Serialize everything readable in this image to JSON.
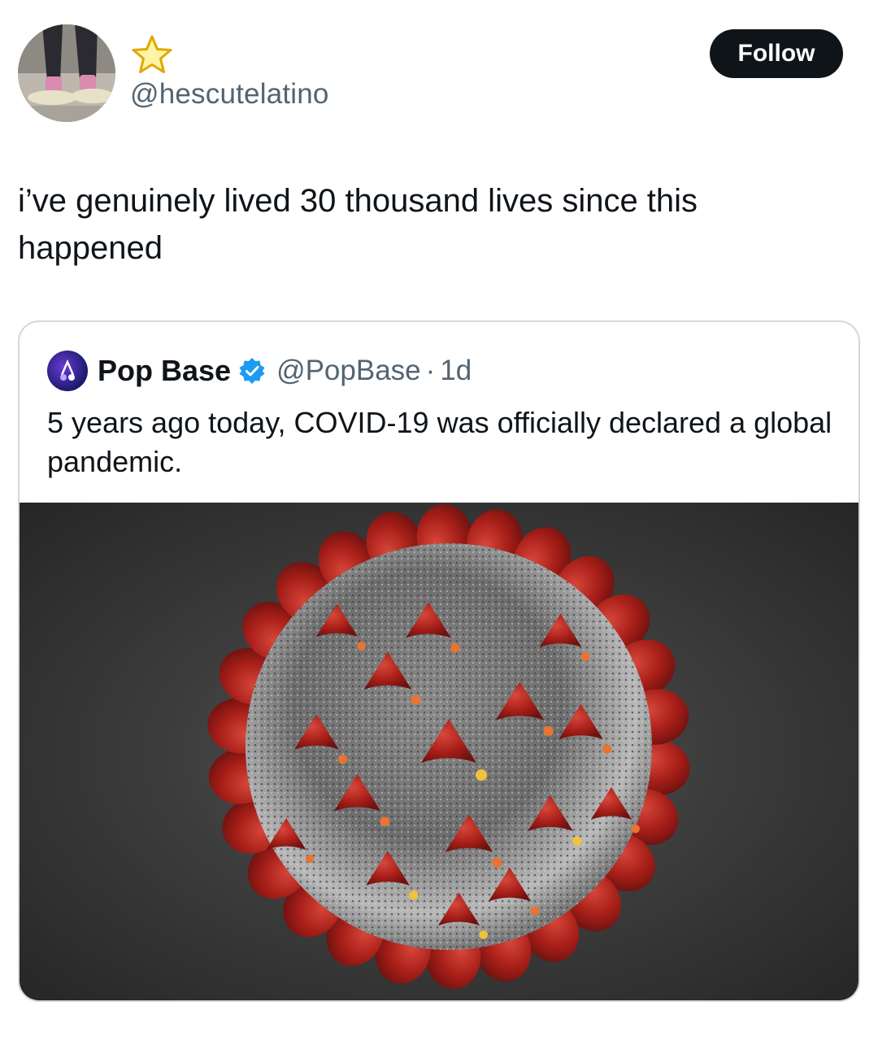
{
  "author": {
    "handle": "@hescutelatino",
    "badge_icon": "star-icon",
    "avatar_icon": "avatar-feet-photo"
  },
  "follow_button": {
    "label": "Follow"
  },
  "tweet": {
    "text": "i’ve genuinely lived 30 thousand lives since this happened"
  },
  "quote": {
    "name": "Pop Base",
    "verified_icon": "verified-badge-icon",
    "handle": "@PopBase",
    "separator": "·",
    "time": "1d",
    "text": "5 years ago today, COVID-19 was officially declared a global pandemic.",
    "media_icon": "coronavirus-illustration"
  },
  "colors": {
    "text_primary": "#0f1419",
    "text_secondary": "#536471",
    "button_bg": "#0f1419",
    "verified": "#1d9bf0",
    "card_border": "#cfd9de",
    "virus_red": "#b3231c",
    "virus_gray": "#9a9a9a"
  }
}
